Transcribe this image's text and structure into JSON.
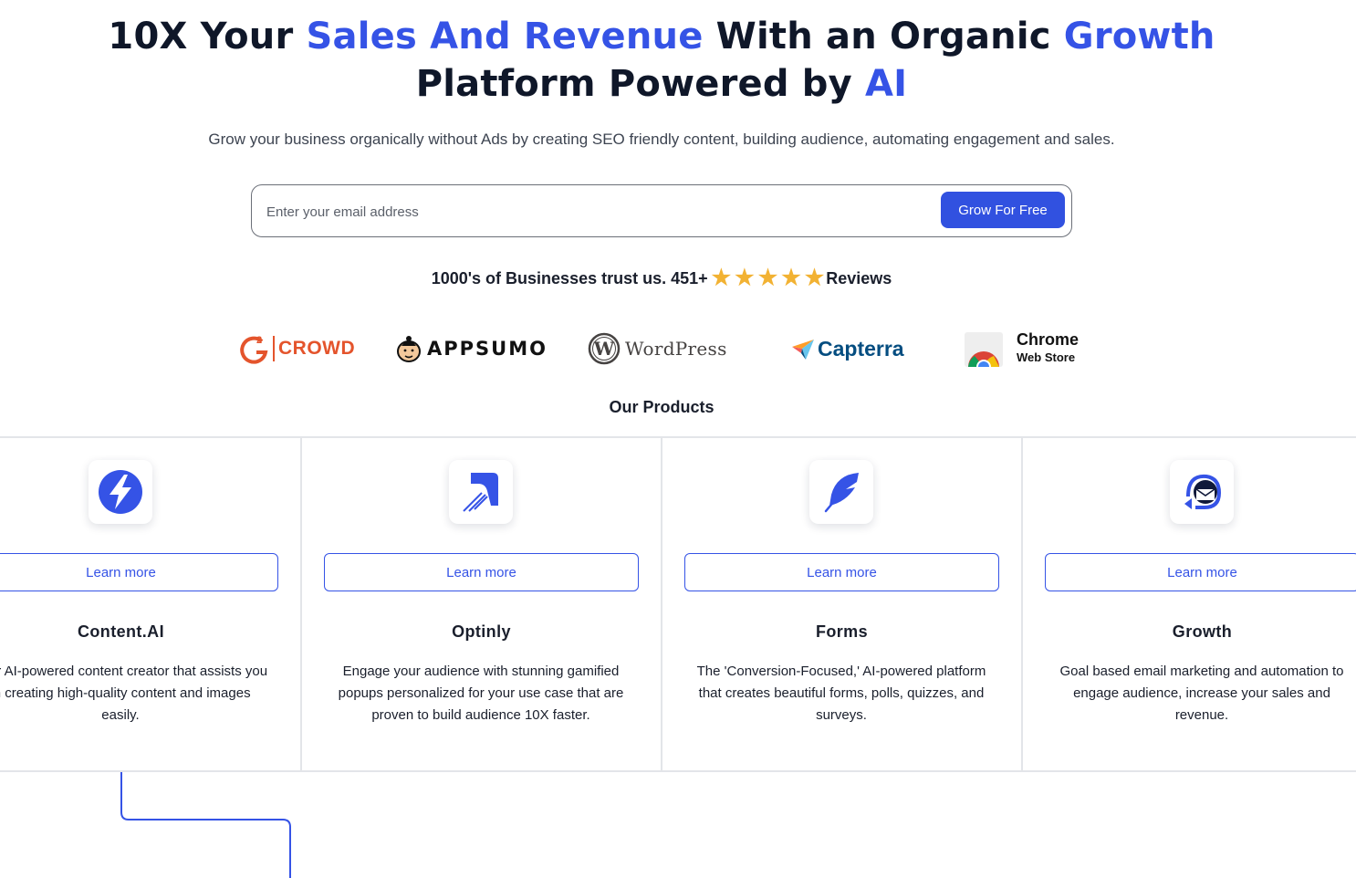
{
  "hero": {
    "title_part1": "10X Your ",
    "title_accent1": "Sales And Revenue",
    "title_part2": " With an Organic ",
    "title_accent2": "Growth",
    "title_part3": "Platform Powered by ",
    "title_accent3": "AI",
    "subtitle": "Grow your business organically without Ads by creating SEO friendly content, building audience, automating engagement and sales."
  },
  "signup": {
    "email_placeholder": "Enter your email address",
    "email_value": "",
    "button_label": "Grow For Free"
  },
  "trust": {
    "text": "1000's of Businesses trust us. 451+",
    "rating_stars": 5,
    "reviews_label": "Reviews"
  },
  "logos": {
    "g2": "CROWD",
    "appsumo": "APPSUMO",
    "wordpress": "WordPress",
    "capterra": "Capterra",
    "chrome_title": "Chrome",
    "chrome_subtitle": "Web Store"
  },
  "colors": {
    "accent": "#3553e6",
    "star": "#f2b233",
    "text_dark": "#0f1729"
  },
  "products": {
    "heading": "Our Products",
    "items": [
      {
        "icon": "content-ai-bolt-icon",
        "learn_more": "Learn more",
        "name": "Content.AI",
        "description": "Your AI-powered content creator that assists you in creating high-quality content and images easily."
      },
      {
        "icon": "optinly-boomerang-icon",
        "learn_more": "Learn more",
        "name": "Optinly",
        "description": "Engage your audience with stunning gamified popups personalized for your use case that are proven to build audience 10X faster."
      },
      {
        "icon": "forms-feather-icon",
        "learn_more": "Learn more",
        "name": "Forms",
        "description": "The 'Conversion-Focused,' AI-powered platform that creates beautiful forms, polls, quizzes, and surveys."
      },
      {
        "icon": "growth-mail-icon",
        "learn_more": "Learn more",
        "name": "Growth",
        "description": "Goal based email marketing and automation to engage audience, increase your sales and revenue."
      }
    ]
  }
}
